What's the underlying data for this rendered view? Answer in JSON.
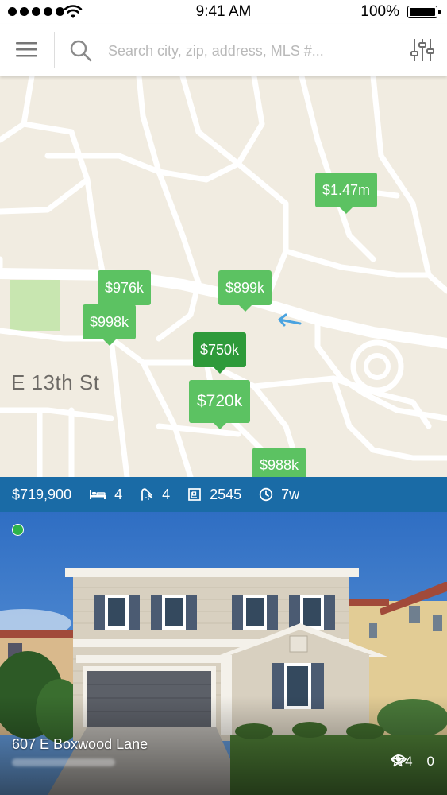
{
  "status_bar": {
    "time": "9:41 AM",
    "battery_pct": "100%"
  },
  "search": {
    "placeholder": "Search city, zip, address, MLS #...",
    "menu_icon": "hamburger-icon",
    "search_icon": "magnifier-icon",
    "filter_icon": "sliders-icon"
  },
  "map": {
    "street_label": "E 13th St",
    "pins": [
      {
        "label": "$1.47m"
      },
      {
        "label": "$976k"
      },
      {
        "label": "$899k"
      },
      {
        "label": "$998k"
      },
      {
        "label": "$750k",
        "selected": true
      },
      {
        "label": "$720k"
      },
      {
        "label": "$988k"
      }
    ],
    "colors": {
      "pin": "#5cc262",
      "pin_selected": "#2e9a3a",
      "land": "#f1ece1",
      "road": "#ffffff",
      "park": "#c8e6b0",
      "direction_arrow": "#4aa3e0"
    }
  },
  "listing": {
    "price": "$719,900",
    "beds": "4",
    "baths": "4",
    "sqft": "2545",
    "age": "7w",
    "address": "607 E Boxwood Lane",
    "views": "4",
    "favorites": "0",
    "info_bar_color": "#1a6ba6",
    "status_color": "#2db34a"
  }
}
